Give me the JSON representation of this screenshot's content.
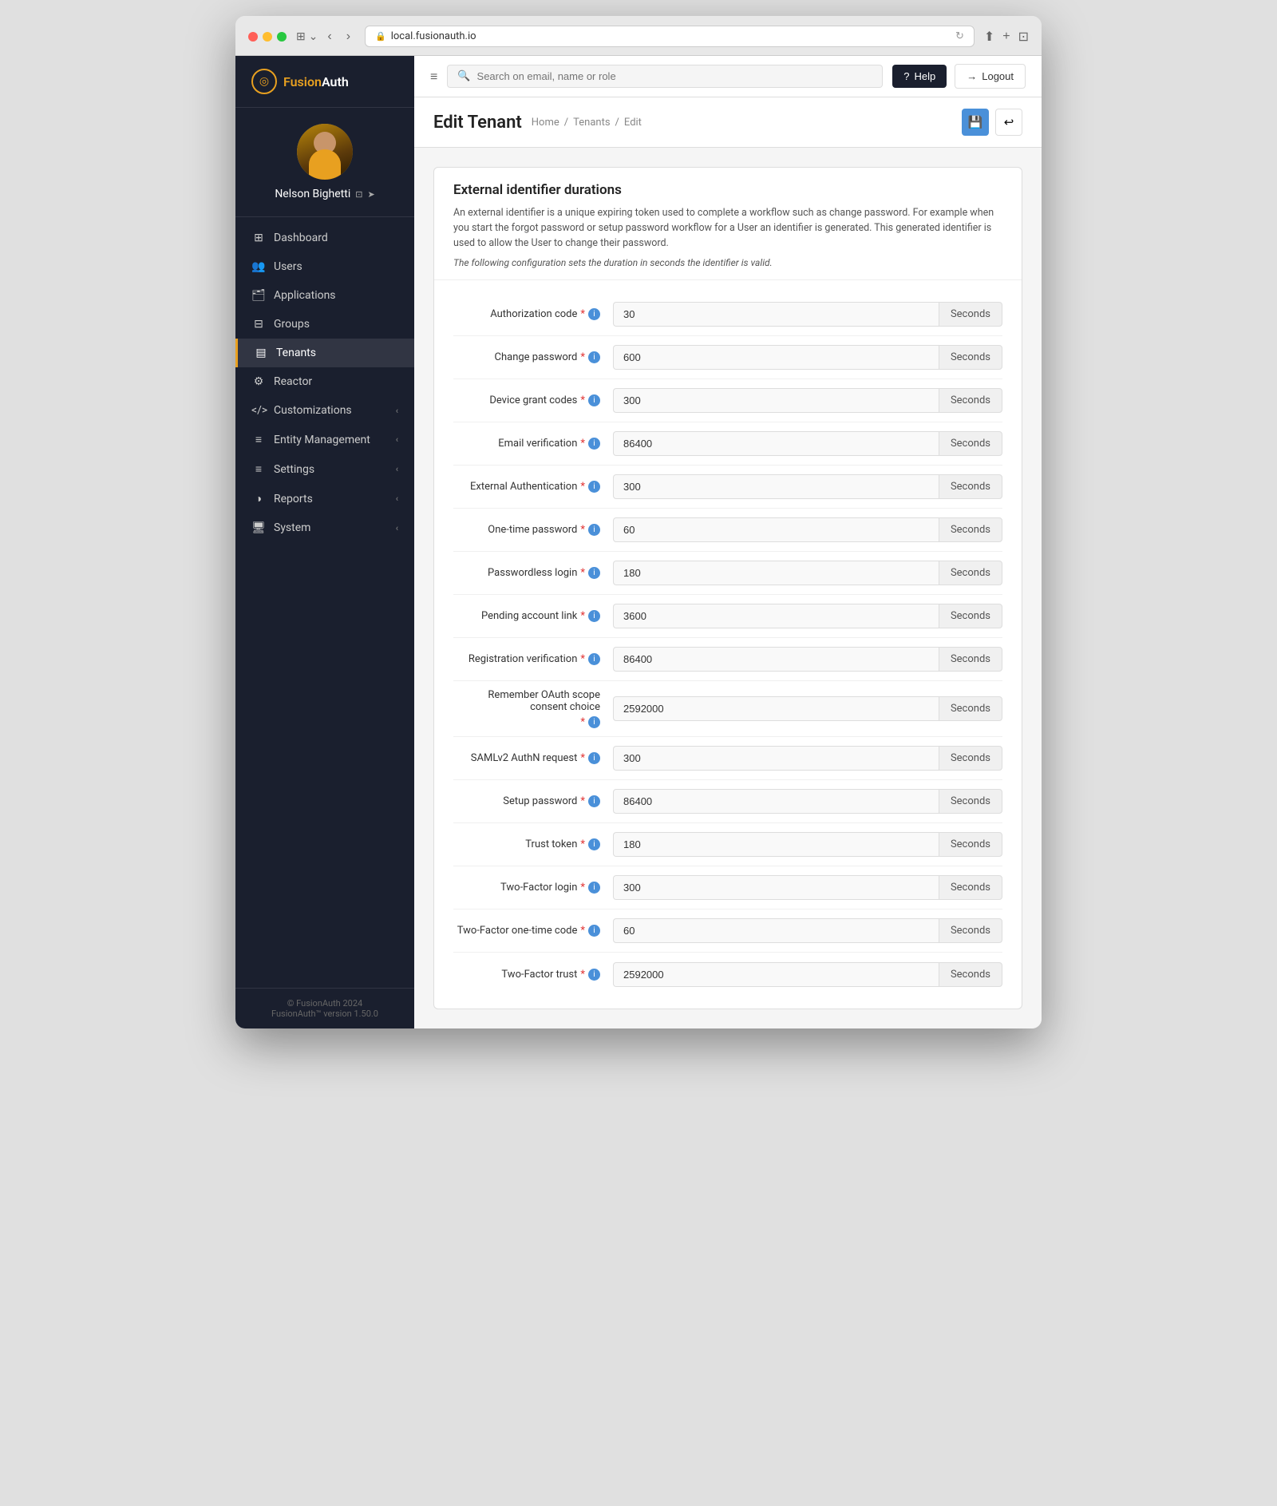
{
  "browser": {
    "address": "local.fusionauth.io",
    "refresh_icon": "↻"
  },
  "sidebar": {
    "logo": {
      "icon": "◎",
      "text_fusion": "Fusion",
      "text_auth": "Auth"
    },
    "user": {
      "name": "Nelson Bighetti"
    },
    "nav_items": [
      {
        "id": "dashboard",
        "icon": "⊞",
        "label": "Dashboard",
        "active": false,
        "has_chevron": false
      },
      {
        "id": "users",
        "icon": "👥",
        "label": "Users",
        "active": false,
        "has_chevron": false
      },
      {
        "id": "applications",
        "icon": "🗂",
        "label": "Applications",
        "active": false,
        "has_chevron": false
      },
      {
        "id": "groups",
        "icon": "⊟",
        "label": "Groups",
        "active": false,
        "has_chevron": false
      },
      {
        "id": "tenants",
        "icon": "▤",
        "label": "Tenants",
        "active": true,
        "has_chevron": false
      },
      {
        "id": "reactor",
        "icon": "⚙",
        "label": "Reactor",
        "active": false,
        "has_chevron": false
      },
      {
        "id": "customizations",
        "icon": "</>",
        "label": "Customizations",
        "active": false,
        "has_chevron": true
      },
      {
        "id": "entity-management",
        "icon": "≡",
        "label": "Entity Management",
        "active": false,
        "has_chevron": true
      },
      {
        "id": "settings",
        "icon": "≡",
        "label": "Settings",
        "active": false,
        "has_chevron": true
      },
      {
        "id": "reports",
        "icon": "◑",
        "label": "Reports",
        "active": false,
        "has_chevron": true
      },
      {
        "id": "system",
        "icon": "🖥",
        "label": "System",
        "active": false,
        "has_chevron": true
      }
    ],
    "footer": {
      "line1": "© FusionAuth 2024",
      "line2": "FusionAuth™ version 1.50.0"
    }
  },
  "topbar": {
    "search_placeholder": "Search on email, name or role",
    "help_label": "Help",
    "logout_label": "Logout"
  },
  "page_header": {
    "title": "Edit Tenant",
    "breadcrumbs": [
      "Home",
      "Tenants",
      "Edit"
    ]
  },
  "section": {
    "title": "External identifier durations",
    "description": "An external identifier is a unique expiring token used to complete a workflow such as change password. For example when you start the forgot password or setup password workflow for a User an identifier is generated. This generated identifier is used to allow the User to change their password.",
    "note": "The following configuration sets the duration in seconds the identifier is valid.",
    "suffix": "Seconds",
    "fields": [
      {
        "id": "authorization-code",
        "label": "Authorization code",
        "required": true,
        "value": "30"
      },
      {
        "id": "change-password",
        "label": "Change password",
        "required": true,
        "value": "600"
      },
      {
        "id": "device-grant-codes",
        "label": "Device grant codes",
        "required": true,
        "value": "300"
      },
      {
        "id": "email-verification",
        "label": "Email verification",
        "required": true,
        "value": "86400"
      },
      {
        "id": "external-authentication",
        "label": "External Authentication",
        "required": true,
        "value": "300",
        "label_two": "Authentication"
      },
      {
        "id": "one-time-password",
        "label": "One-time password",
        "required": true,
        "value": "60"
      },
      {
        "id": "passwordless-login",
        "label": "Passwordless login",
        "required": true,
        "value": "180"
      },
      {
        "id": "pending-account-link",
        "label": "Pending account link",
        "required": true,
        "value": "3600",
        "label_two": "link"
      },
      {
        "id": "registration-verification",
        "label": "Registration verification",
        "required": true,
        "value": "86400",
        "label_two": "verification"
      },
      {
        "id": "remember-oauth-scope-consent-choice",
        "label": "Remember OAuth scope consent choice",
        "required": true,
        "value": "2592000"
      },
      {
        "id": "samlv2-authn-request",
        "label": "SAMLv2 AuthN request",
        "required": true,
        "value": "300",
        "label_two": "request"
      },
      {
        "id": "setup-password",
        "label": "Setup password",
        "required": true,
        "value": "86400"
      },
      {
        "id": "trust-token",
        "label": "Trust token",
        "required": true,
        "value": "180"
      },
      {
        "id": "two-factor-login",
        "label": "Two-Factor login",
        "required": true,
        "value": "300"
      },
      {
        "id": "two-factor-one-time-code",
        "label": "Two-Factor one-time code",
        "required": true,
        "value": "60",
        "label_two": "time code"
      },
      {
        "id": "two-factor-trust",
        "label": "Two-Factor trust",
        "required": true,
        "value": "2592000"
      }
    ]
  }
}
